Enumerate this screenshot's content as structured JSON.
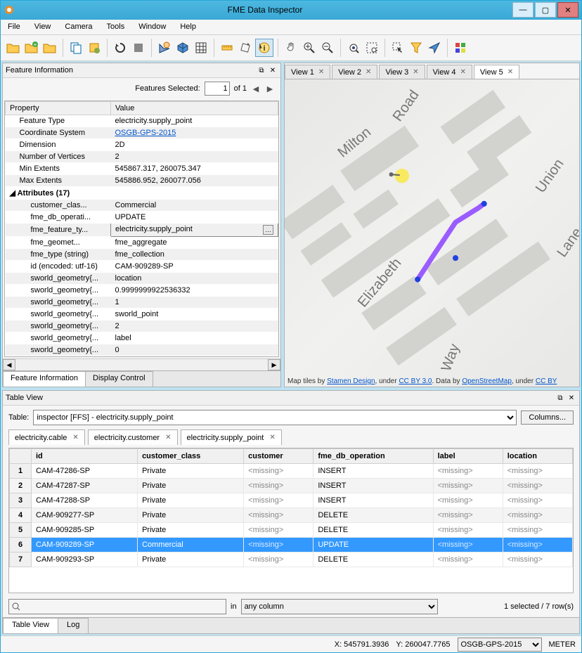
{
  "window": {
    "title": "FME Data Inspector"
  },
  "menu": {
    "items": [
      "File",
      "View",
      "Camera",
      "Tools",
      "Window",
      "Help"
    ]
  },
  "featureInfo": {
    "headerTitle": "Feature Information",
    "featuresSelectedLabel": "Features Selected:",
    "featuresSelectedCount": "1",
    "featuresSelectedOf": "of 1",
    "col0": "Property",
    "col1": "Value",
    "rows": [
      {
        "p": "Feature Type",
        "v": "electricity.supply_point",
        "indent": 1
      },
      {
        "p": "Coordinate System",
        "v": "OSGB-GPS-2015",
        "indent": 1,
        "link": true,
        "stripe": true
      },
      {
        "p": "Dimension",
        "v": "2D",
        "indent": 1
      },
      {
        "p": "Number of Vertices",
        "v": "2",
        "indent": 1,
        "stripe": true
      },
      {
        "p": "Min Extents",
        "v": "545867.317, 260075.347",
        "indent": 1
      },
      {
        "p": "Max Extents",
        "v": "545886.952, 260077.056",
        "indent": 1,
        "stripe": true
      },
      {
        "p": "Attributes (17)",
        "v": "",
        "indent": 0,
        "bold": true,
        "caret": true
      },
      {
        "p": "customer_clas...",
        "v": "Commercial",
        "indent": 2,
        "stripe": true
      },
      {
        "p": "fme_db_operati...",
        "v": "UPDATE",
        "indent": 2
      },
      {
        "p": "fme_feature_ty...",
        "v": "electricity.supply_point",
        "indent": 2,
        "stripe": true,
        "selected": true,
        "more": true
      },
      {
        "p": "fme_geomet...",
        "v": "fme_aggregate",
        "indent": 2
      },
      {
        "p": "fme_type (string)",
        "v": "fme_collection",
        "indent": 2,
        "stripe": true
      },
      {
        "p": "id (encoded: utf-16)",
        "v": "CAM-909289-SP",
        "indent": 2
      },
      {
        "p": "sworld_geometry{...",
        "v": "location",
        "indent": 2,
        "stripe": true
      },
      {
        "p": "sworld_geometry{...",
        "v": "0.9999999922536332",
        "indent": 2
      },
      {
        "p": "sworld_geometry{...",
        "v": "1",
        "indent": 2,
        "stripe": true
      },
      {
        "p": "sworld_geometry{...",
        "v": "sworld_point",
        "indent": 2
      },
      {
        "p": "sworld_geometry{...",
        "v": "2",
        "indent": 2,
        "stripe": true
      },
      {
        "p": "sworld_geometry{...",
        "v": "label",
        "indent": 2
      },
      {
        "p": "sworld_geometry{...",
        "v": "0",
        "indent": 2,
        "stripe": true
      }
    ],
    "tabs": {
      "featureInfo": "Feature Information",
      "displayControl": "Display Control"
    }
  },
  "views": {
    "tabs": [
      {
        "label": "View 1"
      },
      {
        "label": "View 2"
      },
      {
        "label": "View 3"
      },
      {
        "label": "View 4"
      },
      {
        "label": "View 5",
        "active": true
      }
    ],
    "attribution": {
      "prefix": "Map tiles by ",
      "stamen": "Stamen Design",
      "mid1": ", under ",
      "cc": "CC BY 3.0",
      "mid2": ". Data by ",
      "osm": "OpenStreetMap",
      "mid3": ", under ",
      "ccby": "CC BY"
    },
    "streets": {
      "milton": "Milton",
      "road": "Road",
      "elizabeth": "Elizabeth",
      "way": "Way",
      "union": "Union",
      "lane": "Lane"
    }
  },
  "tableView": {
    "headerTitle": "Table View",
    "tableLabel": "Table:",
    "tableSelected": "inspector [FFS] - electricity.supply_point",
    "columnsBtn": "Columns...",
    "tabs": [
      {
        "label": "electricity.cable"
      },
      {
        "label": "electricity.customer"
      },
      {
        "label": "electricity.supply_point",
        "active": true
      }
    ],
    "headers": [
      "id",
      "customer_class",
      "customer",
      "fme_db_operation",
      "label",
      "location"
    ],
    "rows": [
      {
        "n": "1",
        "id": "CAM-47286-SP",
        "cc": "Private",
        "cust": "<missing>",
        "op": "INSERT",
        "label": "<missing>",
        "loc": "<missing>"
      },
      {
        "n": "2",
        "id": "CAM-47287-SP",
        "cc": "Private",
        "cust": "<missing>",
        "op": "INSERT",
        "label": "<missing>",
        "loc": "<missing>",
        "stripe": true
      },
      {
        "n": "3",
        "id": "CAM-47288-SP",
        "cc": "Private",
        "cust": "<missing>",
        "op": "INSERT",
        "label": "<missing>",
        "loc": "<missing>"
      },
      {
        "n": "4",
        "id": "CAM-909277-SP",
        "cc": "Private",
        "cust": "<missing>",
        "op": "DELETE",
        "label": "<missing>",
        "loc": "<missing>",
        "stripe": true
      },
      {
        "n": "5",
        "id": "CAM-909285-SP",
        "cc": "Private",
        "cust": "<missing>",
        "op": "DELETE",
        "label": "<missing>",
        "loc": "<missing>"
      },
      {
        "n": "6",
        "id": "CAM-909289-SP",
        "cc": "Commercial",
        "cust": "<missing>",
        "op": "UPDATE",
        "label": "<missing>",
        "loc": "<missing>",
        "selected": true
      },
      {
        "n": "7",
        "id": "CAM-909293-SP",
        "cc": "Private",
        "cust": "<missing>",
        "op": "DELETE",
        "label": "<missing>",
        "loc": "<missing>"
      }
    ],
    "searchIn": "in",
    "searchSelected": "any column",
    "status": "1 selected / 7 row(s)",
    "bottomTabs": {
      "tableView": "Table View",
      "log": "Log"
    }
  },
  "statusbar": {
    "x": "X:  545791.3936",
    "y": "Y:  260047.7765",
    "crs": "OSGB-GPS-2015",
    "units": "METER"
  }
}
